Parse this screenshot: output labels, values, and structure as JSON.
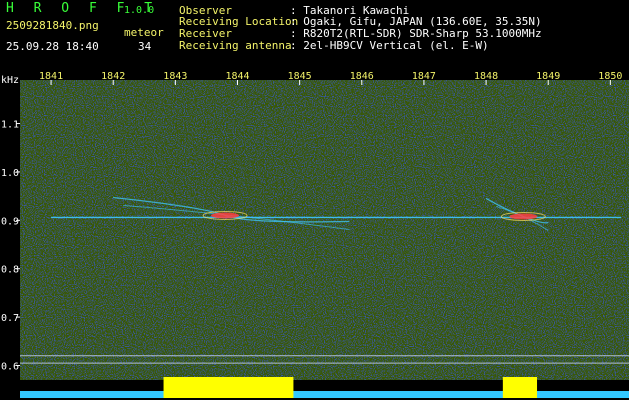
{
  "header": {
    "brand": "H R O F F T",
    "version": "1.0.0",
    "filename": "2509281840.png",
    "datetime": "25.09.28 18:40",
    "meteor_label": "meteor",
    "meteor_count": "34",
    "fields": [
      {
        "label": "Observer",
        "value": ": Takanori Kawachi"
      },
      {
        "label": "Receiving Location",
        "value": ": Ogaki, Gifu, JAPAN (136.60E, 35.35N)"
      },
      {
        "label": "Receiver",
        "value": ": R820T2(RTL-SDR) SDR-Sharp 53.1000MHz"
      },
      {
        "label": "Receiving antenna",
        "value": ": 2el-HB9CV Vertical (el. E-W)"
      }
    ]
  },
  "chart_data": {
    "type": "heatmap",
    "ylabel": "kHz",
    "x_ticks": [
      "1841",
      "1842",
      "1843",
      "1844",
      "1845",
      "1846",
      "1847",
      "1848",
      "1849",
      "1850"
    ],
    "y_ticks": [
      "1.1",
      "1.0",
      "0.9",
      "0.8",
      "0.7",
      "0.6"
    ],
    "ylim": [
      0.57,
      1.19
    ],
    "xlim": [
      1840.5,
      1850.3
    ],
    "carrier_khz": 0.906,
    "echoes": [
      {
        "x_start": 1842.0,
        "x_end": 1845.8,
        "peak_x": 1843.8,
        "freq_khz": 0.91
      },
      {
        "x_start": 1848.0,
        "x_end": 1849.0,
        "peak_x": 1848.6,
        "freq_khz": 0.908
      }
    ],
    "colors": {
      "background": "#050a3a",
      "noise": "#1c2fb0",
      "signal": "#3fc8ff",
      "peak": "#ff4040",
      "strength_bar": "#ffff00",
      "baseline": "#33c8ff"
    }
  }
}
